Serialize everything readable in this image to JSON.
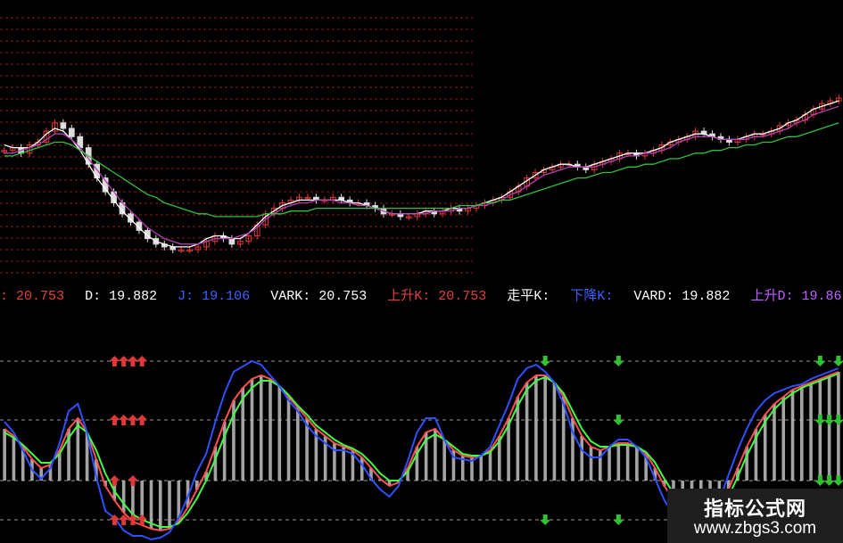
{
  "legend": [
    {
      "label": ":",
      "value": "20.753",
      "color": "#e04040"
    },
    {
      "label": "D:",
      "value": "19.882",
      "color": "#ffffff"
    },
    {
      "label": "J:",
      "value": "19.106",
      "color": "#4060ff"
    },
    {
      "label": "VARK:",
      "value": "20.753",
      "color": "#ffffff"
    },
    {
      "label": "上升K:",
      "value": "20.753",
      "color": "#e04040"
    },
    {
      "label": "走平K:",
      "value": "",
      "color": "#ffffff"
    },
    {
      "label": "下降K:",
      "value": "",
      "color": "#4060ff"
    },
    {
      "label": "VARD:",
      "value": "19.882",
      "color": "#ffffff"
    },
    {
      "label": "上升D:",
      "value": "19.86",
      "color": "#c060ff"
    }
  ],
  "watermark": {
    "title": "指标公式网",
    "url": "www.zbgs3.com"
  },
  "colors": {
    "up": "#e03838",
    "down": "#dcdcdc",
    "ma_white": "#ffffff",
    "ma_purple": "#b040b0",
    "ma_green": "#30c040",
    "k_red": "#ff5050",
    "d_green": "#40ff40",
    "j_blue": "#3050ff",
    "buy_arrow": "#e03838",
    "sell_arrow": "#30c030"
  },
  "chart_data": [
    {
      "type": "candlestick",
      "panel": "price",
      "series": [
        {
          "name": "price",
          "values": [
            45,
            46,
            44,
            47,
            48,
            52,
            55,
            53,
            50,
            46,
            40,
            35,
            30,
            26,
            22,
            19,
            16,
            13,
            11,
            10,
            9,
            9,
            9,
            10,
            12,
            14,
            13,
            11,
            12,
            14,
            18,
            22,
            24,
            26,
            27,
            28,
            28,
            27,
            27,
            28,
            27,
            26,
            26,
            25,
            24,
            22,
            22,
            21,
            21,
            22,
            23,
            22,
            23,
            24,
            23,
            24,
            25,
            26,
            27,
            28,
            30,
            32,
            35,
            37,
            38,
            39,
            40,
            40,
            39,
            38,
            40,
            41,
            42,
            44,
            44,
            43,
            44,
            45,
            47,
            48,
            49,
            50,
            52,
            51,
            50,
            49,
            48,
            49,
            50,
            51,
            51,
            52,
            54,
            55,
            56,
            58,
            60,
            62,
            63,
            64
          ]
        },
        {
          "name": "MA-white",
          "values": [
            47,
            46,
            46,
            46,
            48,
            51,
            53,
            52,
            49,
            45,
            40,
            35,
            31,
            27,
            23,
            20,
            17,
            14,
            12,
            11,
            10,
            10,
            10,
            11,
            13,
            14,
            14,
            13,
            13,
            15,
            18,
            21,
            23,
            25,
            26,
            27,
            27,
            27,
            27,
            27,
            27,
            26,
            26,
            25,
            24,
            23,
            22,
            22,
            22,
            22,
            23,
            23,
            23,
            24,
            24,
            24,
            25,
            26,
            27,
            28,
            30,
            32,
            34,
            36,
            38,
            39,
            40,
            40,
            39,
            39,
            40,
            41,
            42,
            43,
            44,
            44,
            44,
            45,
            46,
            48,
            49,
            50,
            51,
            51,
            50,
            49,
            49,
            49,
            50,
            51,
            51,
            52,
            53,
            55,
            56,
            58,
            60,
            61,
            62,
            63
          ]
        },
        {
          "name": "MA-purple",
          "values": [
            44,
            44,
            45,
            46,
            47,
            49,
            51,
            51,
            49,
            46,
            42,
            38,
            34,
            30,
            26,
            23,
            20,
            17,
            15,
            13,
            12,
            11,
            11,
            11,
            12,
            13,
            13,
            13,
            14,
            15,
            17,
            20,
            22,
            24,
            25,
            26,
            26,
            27,
            27,
            27,
            26,
            26,
            25,
            25,
            24,
            23,
            22,
            22,
            22,
            22,
            22,
            23,
            23,
            23,
            24,
            24,
            25,
            25,
            26,
            27,
            29,
            30,
            32,
            34,
            36,
            37,
            38,
            39,
            39,
            39,
            39,
            40,
            41,
            42,
            43,
            43,
            44,
            44,
            45,
            46,
            48,
            49,
            50,
            50,
            50,
            49,
            49,
            49,
            49,
            50,
            50,
            51,
            52,
            53,
            55,
            56,
            58,
            59,
            60,
            61
          ]
        },
        {
          "name": "MA-green",
          "values": [
            43,
            43,
            44,
            45,
            46,
            47,
            48,
            48,
            47,
            45,
            43,
            41,
            39,
            37,
            35,
            33,
            31,
            29,
            28,
            26,
            25,
            24,
            23,
            22,
            22,
            21,
            21,
            21,
            21,
            21,
            21,
            22,
            22,
            22,
            23,
            23,
            23,
            24,
            24,
            24,
            24,
            24,
            24,
            24,
            24,
            24,
            24,
            24,
            24,
            24,
            24,
            24,
            24,
            24,
            25,
            25,
            25,
            26,
            26,
            27,
            27,
            28,
            29,
            30,
            31,
            32,
            33,
            34,
            35,
            35,
            36,
            37,
            37,
            38,
            39,
            39,
            40,
            40,
            41,
            42,
            42,
            43,
            44,
            44,
            45,
            45,
            46,
            46,
            47,
            47,
            48,
            48,
            49,
            50,
            50,
            51,
            52,
            53,
            54,
            55
          ]
        }
      ]
    },
    {
      "type": "line",
      "panel": "KDJ",
      "ylim": [
        0,
        100
      ],
      "series": [
        {
          "name": "K",
          "values": [
            62,
            58,
            52,
            45,
            40,
            42,
            50,
            62,
            68,
            60,
            45,
            30,
            22,
            15,
            10,
            8,
            6,
            5,
            6,
            10,
            18,
            28,
            38,
            52,
            66,
            78,
            85,
            90,
            92,
            90,
            86,
            80,
            74,
            68,
            62,
            58,
            54,
            52,
            50,
            46,
            40,
            34,
            30,
            32,
            40,
            52,
            60,
            62,
            56,
            50,
            47,
            46,
            47,
            50,
            58,
            68,
            80,
            88,
            92,
            92,
            88,
            80,
            68,
            58,
            52,
            50,
            52,
            54,
            54,
            52,
            48,
            40,
            30,
            22,
            16,
            12,
            10,
            12,
            18,
            28,
            40,
            52,
            62,
            70,
            76,
            80,
            84,
            86,
            88,
            90,
            92,
            94
          ]
        },
        {
          "name": "D",
          "values": [
            60,
            57,
            53,
            48,
            43,
            43,
            48,
            57,
            64,
            60,
            50,
            37,
            27,
            20,
            14,
            11,
            9,
            7,
            7,
            9,
            15,
            23,
            33,
            45,
            58,
            70,
            79,
            85,
            89,
            89,
            86,
            81,
            75,
            70,
            64,
            60,
            56,
            53,
            51,
            48,
            43,
            37,
            33,
            33,
            38,
            48,
            56,
            59,
            56,
            52,
            48,
            47,
            47,
            49,
            55,
            64,
            75,
            84,
            89,
            91,
            88,
            82,
            72,
            62,
            55,
            52,
            52,
            53,
            53,
            52,
            49,
            43,
            34,
            26,
            20,
            15,
            12,
            12,
            16,
            24,
            35,
            47,
            57,
            66,
            73,
            78,
            82,
            85,
            87,
            89,
            91,
            93
          ]
        },
        {
          "name": "J",
          "values": [
            66,
            60,
            50,
            39,
            34,
            40,
            54,
            72,
            76,
            60,
            35,
            16,
            12,
            5,
            2,
            2,
            0,
            1,
            4,
            12,
            24,
            38,
            48,
            66,
            82,
            94,
            97,
            100,
            98,
            92,
            86,
            78,
            72,
            64,
            58,
            54,
            50,
            50,
            48,
            42,
            34,
            28,
            24,
            30,
            44,
            60,
            68,
            68,
            56,
            46,
            45,
            44,
            47,
            52,
            64,
            76,
            90,
            96,
            98,
            94,
            88,
            76,
            60,
            50,
            46,
            46,
            52,
            56,
            56,
            52,
            46,
            34,
            22,
            14,
            8,
            6,
            6,
            12,
            22,
            36,
            50,
            62,
            72,
            78,
            82,
            84,
            86,
            87,
            90,
            92,
            94,
            96
          ]
        }
      ],
      "buy_signals": [
        {
          "x": 12,
          "levels": [
            100,
            67,
            33,
            0
          ]
        },
        {
          "x": 13,
          "levels": [
            100,
            67,
            0
          ]
        },
        {
          "x": 14,
          "levels": [
            100,
            67,
            33,
            0
          ]
        },
        {
          "x": 15,
          "levels": [
            100,
            67,
            0
          ]
        }
      ],
      "sell_signals": [
        {
          "x": 59,
          "levels": [
            100,
            0
          ]
        },
        {
          "x": 67,
          "levels": [
            100,
            67,
            0
          ]
        },
        {
          "x": 89,
          "levels": [
            100,
            67,
            33
          ]
        },
        {
          "x": 90,
          "levels": [
            67,
            33
          ]
        },
        {
          "x": 91,
          "levels": [
            100,
            67,
            33
          ]
        }
      ]
    }
  ]
}
